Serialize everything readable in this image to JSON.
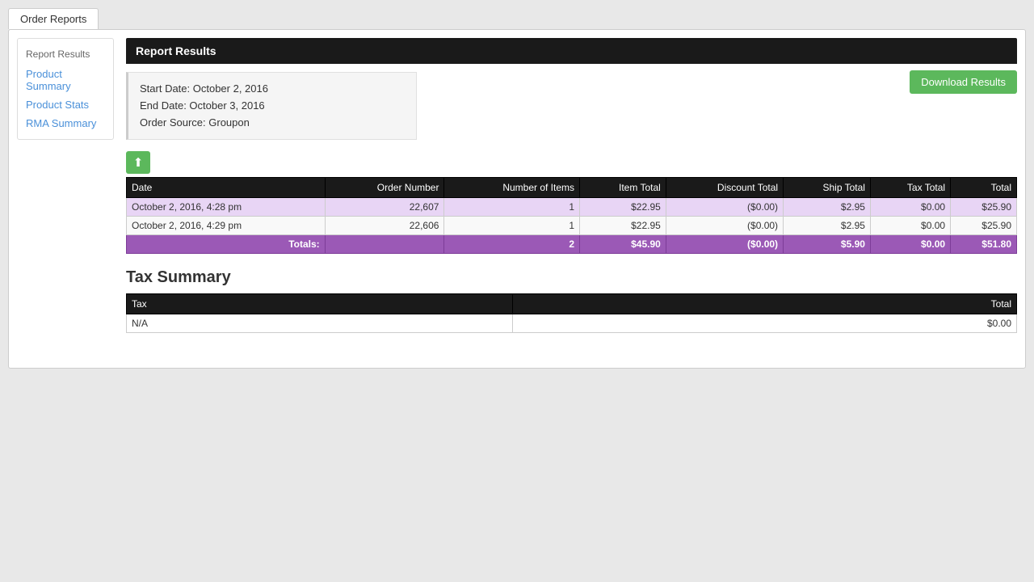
{
  "tabs": {
    "order_reports": "Order Reports"
  },
  "sidebar": {
    "title": "Report Results",
    "links": [
      {
        "label": "Product Summary",
        "id": "product-summary"
      },
      {
        "label": "Product Stats",
        "id": "product-stats"
      },
      {
        "label": "RMA Summary",
        "id": "rma-summary"
      }
    ]
  },
  "report": {
    "header": "Report Results",
    "filter": {
      "start_date": "Start Date: October 2, 2016",
      "end_date": "End Date: October 3, 2016",
      "order_source": "Order Source: Groupon"
    },
    "download_btn": "Download Results",
    "columns": [
      "Date",
      "Order Number",
      "Number of Items",
      "Item Total",
      "Discount Total",
      "Ship Total",
      "Tax Total",
      "Total"
    ],
    "rows": [
      {
        "date": "October 2, 2016, 4:28 pm",
        "order_number": "22,607",
        "num_items": "1",
        "item_total": "$22.95",
        "discount_total": "($0.00)",
        "ship_total": "$2.95",
        "tax_total": "$0.00",
        "total": "$25.90",
        "style": "odd"
      },
      {
        "date": "October 2, 2016, 4:29 pm",
        "order_number": "22,606",
        "num_items": "1",
        "item_total": "$22.95",
        "discount_total": "($0.00)",
        "ship_total": "$2.95",
        "tax_total": "$0.00",
        "total": "$25.90",
        "style": "even"
      }
    ],
    "totals": {
      "label": "Totals:",
      "order_number": "",
      "num_items": "2",
      "item_total": "$45.90",
      "discount_total": "($0.00)",
      "ship_total": "$5.90",
      "tax_total": "$0.00",
      "total": "$51.80"
    }
  },
  "tax_summary": {
    "title": "Tax Summary",
    "columns": [
      "Tax",
      "Total"
    ],
    "rows": [
      {
        "tax": "N/A",
        "total": "$0.00"
      }
    ]
  },
  "export_icon": "⬆"
}
